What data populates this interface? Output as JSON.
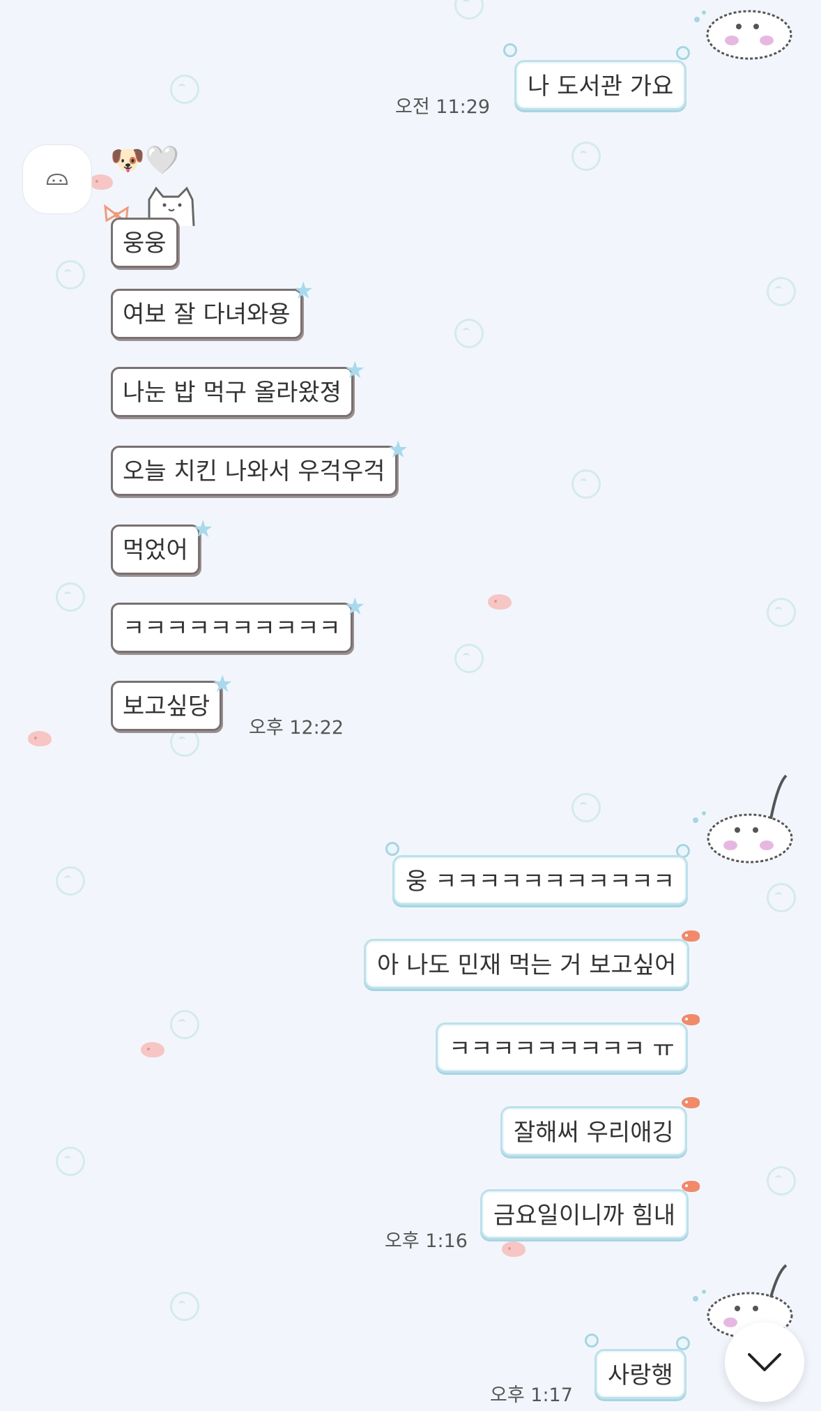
{
  "messages": {
    "m1": {
      "text": "나 도서관 가요",
      "time": "오전 11:29"
    },
    "sender_name": "🐶🤍",
    "m2": {
      "text": "웅웅"
    },
    "m3": {
      "text": "여보 잘 다녀와용"
    },
    "m4": {
      "text": "나눈 밥 먹구 올라왔졍"
    },
    "m5": {
      "text": "오늘 치킨 나와서 우걱우걱"
    },
    "m6": {
      "text": "먹었어"
    },
    "m7": {
      "text": "ㅋㅋㅋㅋㅋㅋㅋㅋㅋㅋ"
    },
    "m8": {
      "text": "보고싶당",
      "time": "오후 12:22"
    },
    "m9": {
      "text": "웅 ㅋㅋㅋㅋㅋㅋㅋㅋㅋㅋㅋ"
    },
    "m10": {
      "text": "아 나도 민재 먹는 거 보고싶어"
    },
    "m11": {
      "text": "ㅋㅋㅋㅋㅋㅋㅋㅋㅋ ㅠ"
    },
    "m12": {
      "text": "잘해써 우리애깅"
    },
    "m13": {
      "text": "금요일이니까 힘내",
      "time": "오후 1:16"
    },
    "m14": {
      "text": "사랑행",
      "time": "오후 1:17"
    }
  },
  "icons": {
    "avatar": "avatar-placeholder-icon",
    "scroll": "chevron-down-icon"
  },
  "colors": {
    "background": "#f2f6fc",
    "outgoing_border": "#bde0ea",
    "incoming_border": "#7a7070",
    "accent_fish": "#f08a6a"
  }
}
